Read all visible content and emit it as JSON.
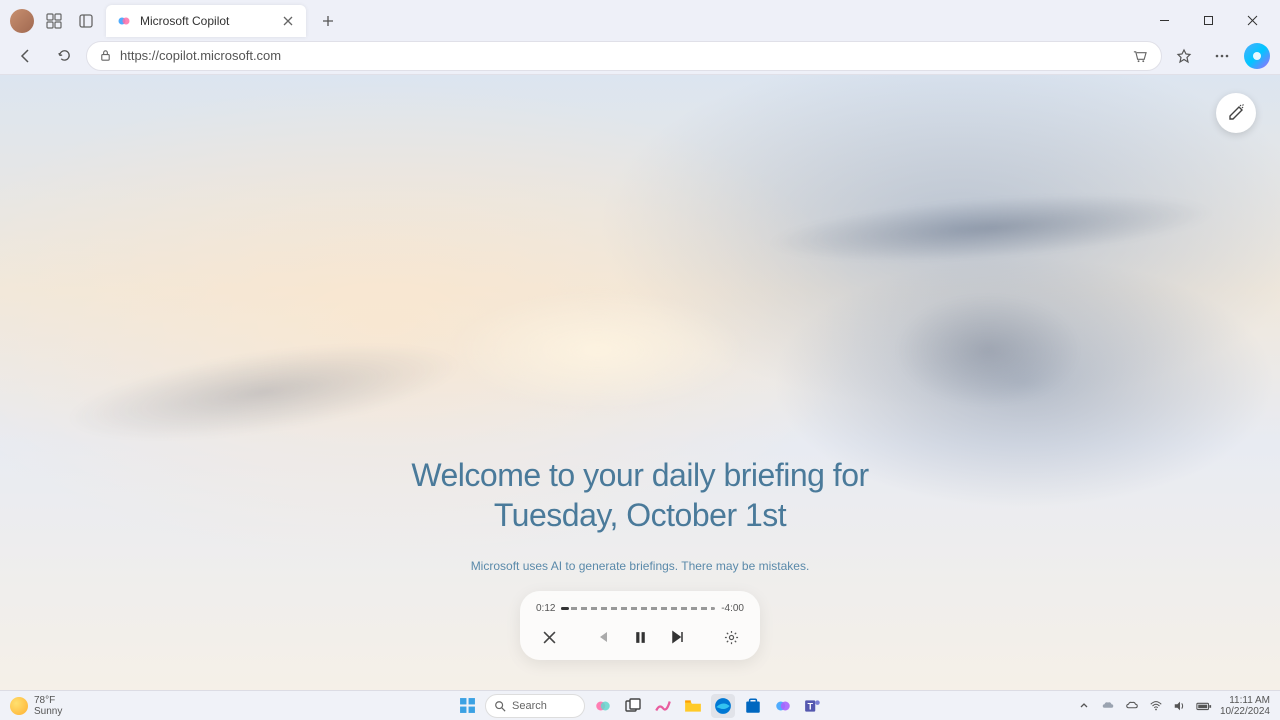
{
  "browser": {
    "tab_title": "Microsoft Copilot",
    "url": "https://copilot.microsoft.com"
  },
  "page": {
    "title_line1": "Welcome to your daily briefing for",
    "title_line2": "Tuesday, October 1st",
    "disclaimer": "Microsoft uses AI to generate briefings. There may be mistakes."
  },
  "player": {
    "elapsed": "0:12",
    "remaining": "-4:00",
    "progress_percent": 5
  },
  "taskbar": {
    "weather_temp": "78°F",
    "weather_cond": "Sunny",
    "search_placeholder": "Search",
    "time": "11:11 AM",
    "date": "10/22/2024"
  }
}
